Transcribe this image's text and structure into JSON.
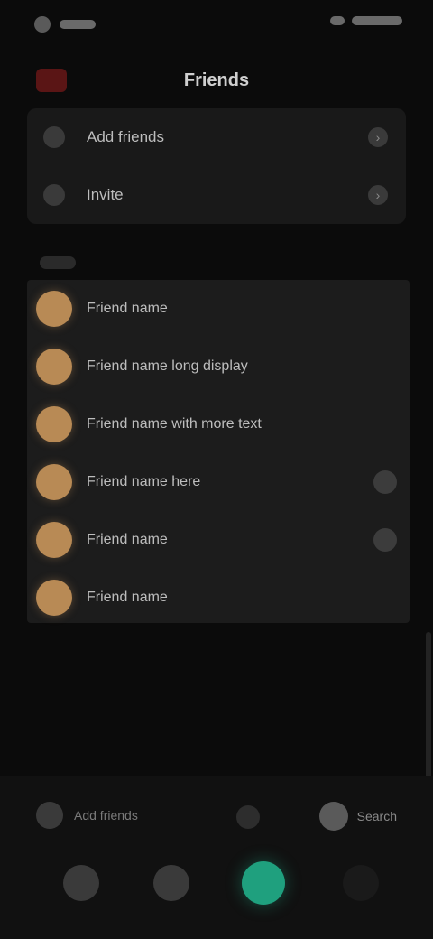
{
  "status_bar": {
    "time": "",
    "icons": [
      "signal-icon",
      "wifi-icon",
      "battery-icon"
    ]
  },
  "header": {
    "title": "Friends",
    "badge_color": "#5a1515"
  },
  "top_card": {
    "rows": [
      {
        "label": "Add friends",
        "icon": "add-user-icon"
      },
      {
        "label": "Invite",
        "icon": "share-icon"
      }
    ]
  },
  "section": {
    "label": ""
  },
  "friends": [
    {
      "name": "Friend name",
      "has_action": false
    },
    {
      "name": "Friend name long display",
      "has_action": false
    },
    {
      "name": "Friend name with more text",
      "has_action": false
    },
    {
      "name": "Friend name here",
      "has_action": true
    },
    {
      "name": "Friend name",
      "has_action": true
    },
    {
      "name": "Friend name",
      "has_action": false
    }
  ],
  "footer": {
    "line1": "",
    "line2": ""
  },
  "bottom": {
    "left_label": "Add friends",
    "right_label": "Search"
  },
  "nav": {
    "items": [
      "home-icon",
      "discover-icon",
      "create-icon",
      "profile-icon"
    ]
  },
  "colors": {
    "accent": "#1fa07e",
    "avatar": "#b88a55",
    "background": "#0b0b0b",
    "card": "#191919"
  }
}
